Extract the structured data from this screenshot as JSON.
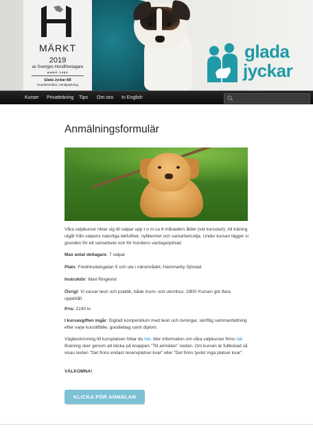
{
  "header": {
    "badge": {
      "title": "MÄRKT",
      "year": "2019",
      "org": "av Sveriges Hundföretagare",
      "anno": "ANNO 1983",
      "company": "Glada Jyckar AB",
      "role": "Hundinstruktör, Hundpsykolog"
    },
    "logo": {
      "line1": "glada",
      "line2": "jyckar",
      "color": "#1f9aa6"
    }
  },
  "nav": {
    "items": [
      {
        "label": "Kurser"
      },
      {
        "label": "Privatträning"
      },
      {
        "label": "Tips"
      },
      {
        "label": "Om oss"
      },
      {
        "label": "In English"
      }
    ],
    "search": {
      "icon": "search-icon",
      "placeholder": ""
    }
  },
  "main": {
    "title": "Anmälningsformulär",
    "intro": "Våra valpkurser riktar sig till valpar upp t o m ca 6 månaders ålder (vid kursstart). All träning utgår från valpens naturliga lekfullhet, nyfikenhet och samarbetsvilja. Under kursen lägger vi grunden för ett samarbete och för hundens vardagslydnad.",
    "max_label": "Max antal deltagare",
    "max_value": ": 7 valpar",
    "place_label": "Plats",
    "place_value": ": Fredriksdalsgatan 5 och ute i närområdet, Hammarby Sjöstad",
    "instructor_label": "Instruktör",
    "instructor_value": ": Mari Ringkvist",
    "other_label": "Övrigt",
    "other_value": ": Vi varvar teori och praktik, både inom- och utomhus. OBS! Kursen gör flera uppehåll.",
    "price_label": "Pris:",
    "price_value": " 2190 kr",
    "included_label": "I kursavgiften ingår",
    "included_value": ": Digitalt kompendium med teori och övningar, skriftlig sammanfattning efter varje kurstillfälle, goodiebag samt diplom.",
    "directions_text": "Vägbeskrivning till kursplatsen hittar du ",
    "directions_link": "här",
    "more_info_text": ". Mer information om våra valpkurser finns ",
    "more_info_link": "här",
    "booking_text": " Bokning sker genom att klicka på knappen \"Till anmälan\" nedan. Om kursen är fullbokad så visas texten \"Det finns endast reservplatser kvar\" eller \"Det finns tyvärr inga platser kvar\".",
    "welcome": "VÄLKOMNA!",
    "cta_label": "KLICKA FÖR ANMÄLAN",
    "cta_color": "#7cc1d6",
    "link_color": "#1b8be0"
  }
}
